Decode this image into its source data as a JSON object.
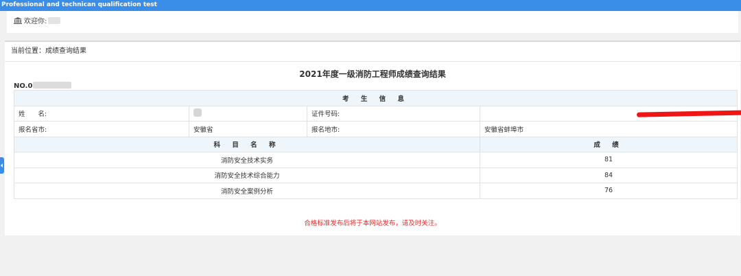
{
  "header": {
    "title": "Professional and technican qualification test"
  },
  "welcome": {
    "label": "欢迎你:"
  },
  "breadcrumb": {
    "text": "当前位置：成绩查询结果"
  },
  "result": {
    "title": "2021年度一级消防工程师成绩查询结果",
    "reg_no_prefix": "NO.0"
  },
  "candidate": {
    "section_title": "考 生 信 息",
    "name_label": "姓　　名:",
    "id_label": "证件号码:",
    "province_label": "报名省市:",
    "province_value": "安徽省",
    "city_label": "报名地市:",
    "city_value": "安徽省蚌埠市"
  },
  "scores": {
    "subject_header": "科 目 名 称",
    "score_header": "成 绩",
    "rows": [
      {
        "subject": "消防安全技术实务",
        "score": "81"
      },
      {
        "subject": "消防安全技术综合能力",
        "score": "84"
      },
      {
        "subject": "消防安全案例分析",
        "score": "76"
      }
    ]
  },
  "note": "合格标准发布后将于本网站发布，请及时关注。",
  "icons": {
    "welcome": "bank-icon",
    "side": "chevron-left-icon"
  },
  "colors": {
    "header": "#3b8ee8",
    "note": "#e12b2b",
    "redaction": "#f01616"
  }
}
